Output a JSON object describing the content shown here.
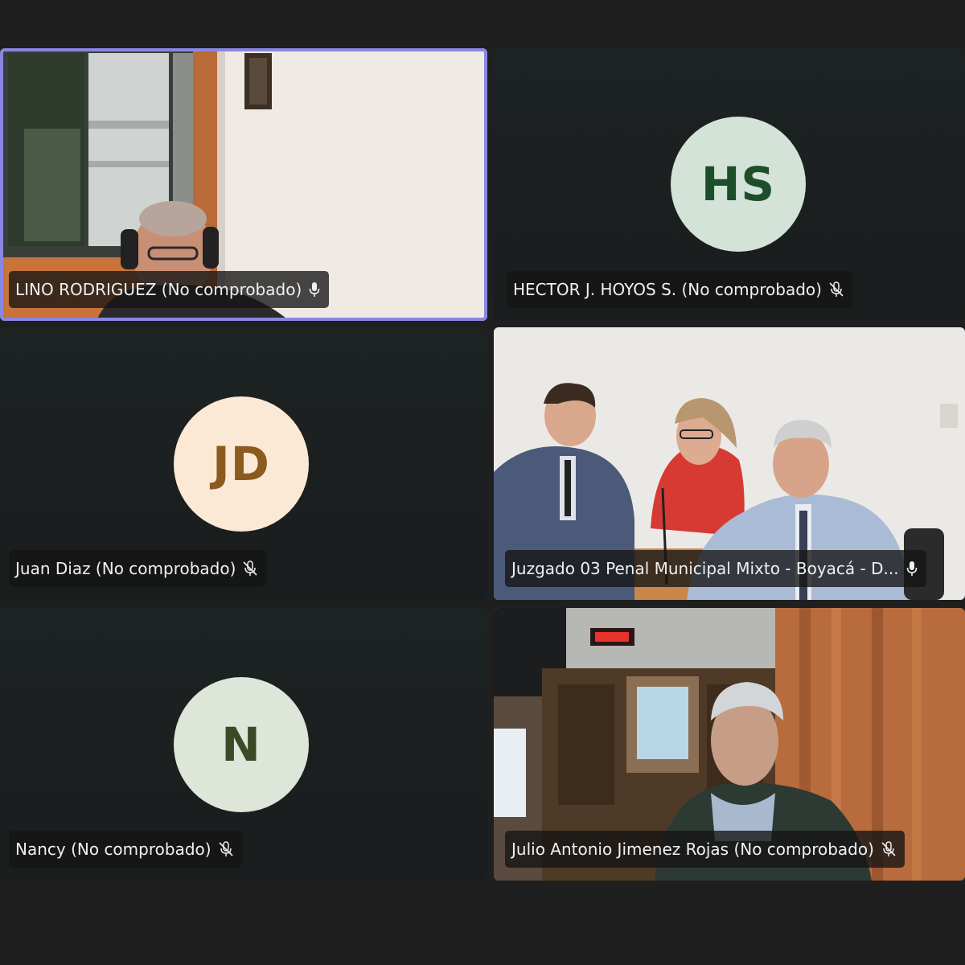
{
  "participants": [
    {
      "name": "LINO RODRIGUEZ (No comprobado)",
      "mic": "mic-on",
      "active": true,
      "video": true
    },
    {
      "name": "HECTOR J. HOYOS S. (No comprobado)",
      "mic": "mic-off",
      "initials": "HS",
      "avatar_bg": "#d3e3d8",
      "avatar_fg": "#1e4d2b"
    },
    {
      "name": "Juan Diaz (No comprobado)",
      "mic": "mic-off",
      "initials": "JD",
      "avatar_bg": "#fbe9d6",
      "avatar_fg": "#8a5a1e"
    },
    {
      "name": "Juzgado 03 Penal Municipal Mixto - Boyacá - D...",
      "mic": "mic-on",
      "video": true
    },
    {
      "name": "Nancy (No comprobado)",
      "mic": "mic-off",
      "initials": "N",
      "avatar_bg": "#dde6d8",
      "avatar_fg": "#3a4a26"
    },
    {
      "name": "Julio Antonio Jimenez Rojas (No comprobado)",
      "mic": "mic-off",
      "video": true
    }
  ],
  "colors": {
    "active_border": "#8a87e3",
    "background": "#1f1f1f"
  }
}
